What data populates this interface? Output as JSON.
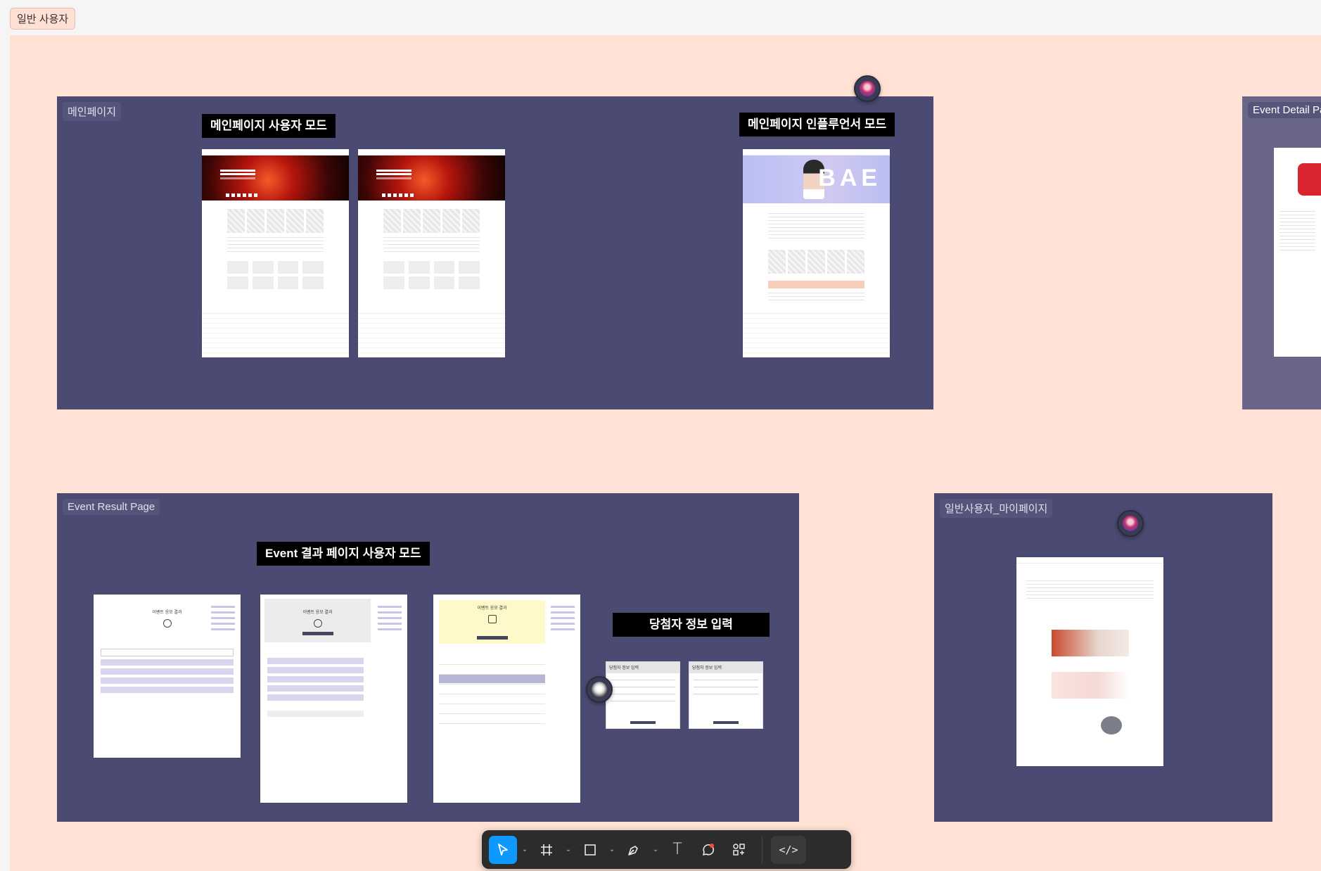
{
  "section": {
    "label": "일반 사용자"
  },
  "frames": {
    "main": {
      "label": "메인페이지"
    },
    "event_detail": {
      "label": "Event Detail Pa"
    },
    "event_result": {
      "label": "Event Result Page"
    },
    "mypage": {
      "label": "일반사용자_마이페이지"
    }
  },
  "stickers": {
    "main_user": "메인페이지 사용자 모드",
    "main_influencer": "메인페이지 인플루언서 모드",
    "event_result_user": "Event 결과 페이지 사용자 모드",
    "winner_input": "당첨자 정보 입력"
  },
  "thumbnails": {
    "influencer_hero_text": "BAE",
    "result_title_1": "이벤트 응모 결과",
    "result_title_2": "이벤트 응모 결과",
    "result_title_3": "이벤트 응모 결과",
    "form_title_1": "당첨자 정보 입력",
    "form_title_2": "당첨자 정보 입력"
  },
  "toolbar": {
    "move_icon": "cursor-arrow-icon",
    "frame_icon": "frame-hash-icon",
    "shape_icon": "rectangle-icon",
    "pen_icon": "pen-icon",
    "text_icon": "text-T-icon",
    "comment_icon": "comment-bubble-icon",
    "actions_icon": "actions-grid-icon",
    "dev_mode_icon": "dev-mode-code-icon",
    "text_glyph": "T",
    "code_glyph": "</>"
  },
  "colors": {
    "canvas": "#ffe2d5",
    "frame": "#4a4a72",
    "active_tool": "#0d99ff"
  }
}
